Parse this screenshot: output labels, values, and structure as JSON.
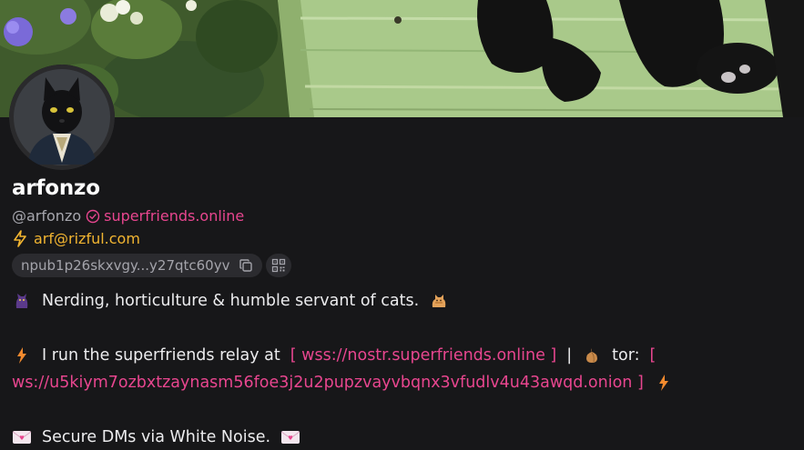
{
  "profile": {
    "display_name": "arfonzo",
    "handle": "@arfonzo",
    "nip05_domain": "superfriends.online",
    "lightning_address": "arf@rizful.com",
    "npub_short": "npub1p26skxvgy...y27qtc60yv"
  },
  "about": {
    "line1": "Nerding, horticulture & humble servant of cats.",
    "line2_prefix": "I run the superfriends relay at",
    "relay_link": "[ wss://nostr.superfriends.online ]",
    "separator": "|",
    "tor_label": "tor:",
    "tor_bracket_open": "[",
    "onion_link": "ws://u5kiym7ozbxtzaynasm56foe3j2u2pupzvayvbqnx3vfudlv4u43awqd.onion ]",
    "line4": "Secure DMs via White Noise."
  },
  "icons": {
    "verified": "check-circle-icon",
    "lightning": "lightning-bolt-icon",
    "copy": "copy-icon",
    "qr": "qr-code-icon"
  },
  "colors": {
    "background": "#171719",
    "accent_pink": "#e8468f",
    "lightning_yellow": "#f2b531",
    "muted_text": "#a6a6ad",
    "pill_bg": "#2b2b2f"
  }
}
